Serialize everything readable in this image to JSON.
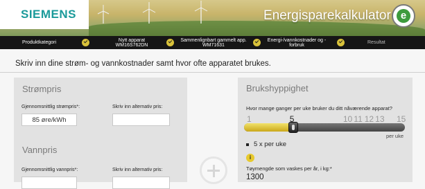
{
  "header": {
    "brand": "SIEMENS",
    "app_title": "Energisparekalkulator",
    "eco_symbol": "e"
  },
  "steps": [
    {
      "label": "Produktkategori",
      "done": true
    },
    {
      "label": "Nytt apparat WM16S762DN",
      "done": true
    },
    {
      "label": "Sammenlignbart gammelt app. WM71631",
      "done": true
    },
    {
      "label": "Energi-/vannkostnader og -forbruk",
      "done": true
    },
    {
      "label": "Resultat",
      "done": false
    }
  ],
  "instruction": "Skriv inn dine strøm- og vannkostnader samt hvor ofte apparatet brukes.",
  "left_panel": {
    "strom_title": "Strømpris",
    "avg_strom_label": "Gjennomsnittlig strømpris*:",
    "avg_strom_value": "85 øre/kWh",
    "alt_strom_label": "Skriv inn alternativ pris:",
    "alt_strom_value": "",
    "vann_title": "Vannpris",
    "avg_vann_label": "Gjennomsnittlig vannpris*:",
    "alt_vann_label": "Skriv inn alternativ pris:"
  },
  "right_panel": {
    "title": "Brukshyppighet",
    "question": "Hvor mange ganger per uke bruker du ditt nåværende apparat?",
    "slider_labels": [
      "1",
      "",
      "",
      "",
      "5",
      "",
      "",
      "",
      "",
      "10",
      "11",
      "12",
      "13",
      "",
      "15"
    ],
    "slider_value": 5,
    "slider_min": 1,
    "slider_max": 15,
    "per_week_unit": "per uke",
    "selected_text": "5 x per uke",
    "info_symbol": "i",
    "weight_label": "Tøymengde som vaskes per år, i kg:*",
    "weight_value": "1300"
  },
  "colors": {
    "brand": "#1a9a9a",
    "step_bar": "#161616",
    "accent_yellow": "#d9c23a",
    "panel_bg": "#e2e2e2"
  }
}
